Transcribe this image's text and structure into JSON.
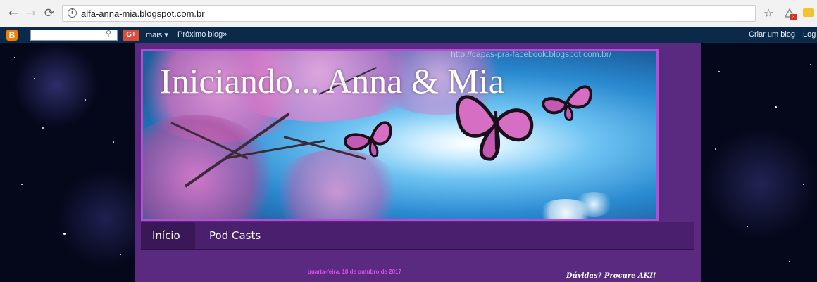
{
  "browser": {
    "url": "alfa-anna-mia.blogspot.com.br",
    "back_icon": "arrow-left-icon",
    "forward_icon": "arrow-right-icon",
    "reload_icon": "reload-icon",
    "bookmark_icon": "star-icon",
    "extension_badge": "3"
  },
  "blogger_bar": {
    "more_label": "mais ▾",
    "next_blog_label": "Próximo blog»",
    "create_blog_label": "Criar um blog",
    "login_label": "Log",
    "gplus_label": "G+",
    "logo_letter": "B"
  },
  "header": {
    "title": "Iniciando... Anna & Mia",
    "watermark": "http://capas-pra-facebook.blogspot.com.br/"
  },
  "tabs": [
    {
      "label": "Início",
      "active": true
    },
    {
      "label": "Pod Casts",
      "active": false
    }
  ],
  "post": {
    "date": "quarta-feira, 18 de outubro de 2017"
  },
  "sidebar": {
    "title": "Dúvidas? Procure AKI!"
  },
  "colors": {
    "blog_background": "#5a2a80",
    "tab_bar": "#4a1f6e",
    "date_color": "#d94fe8"
  }
}
